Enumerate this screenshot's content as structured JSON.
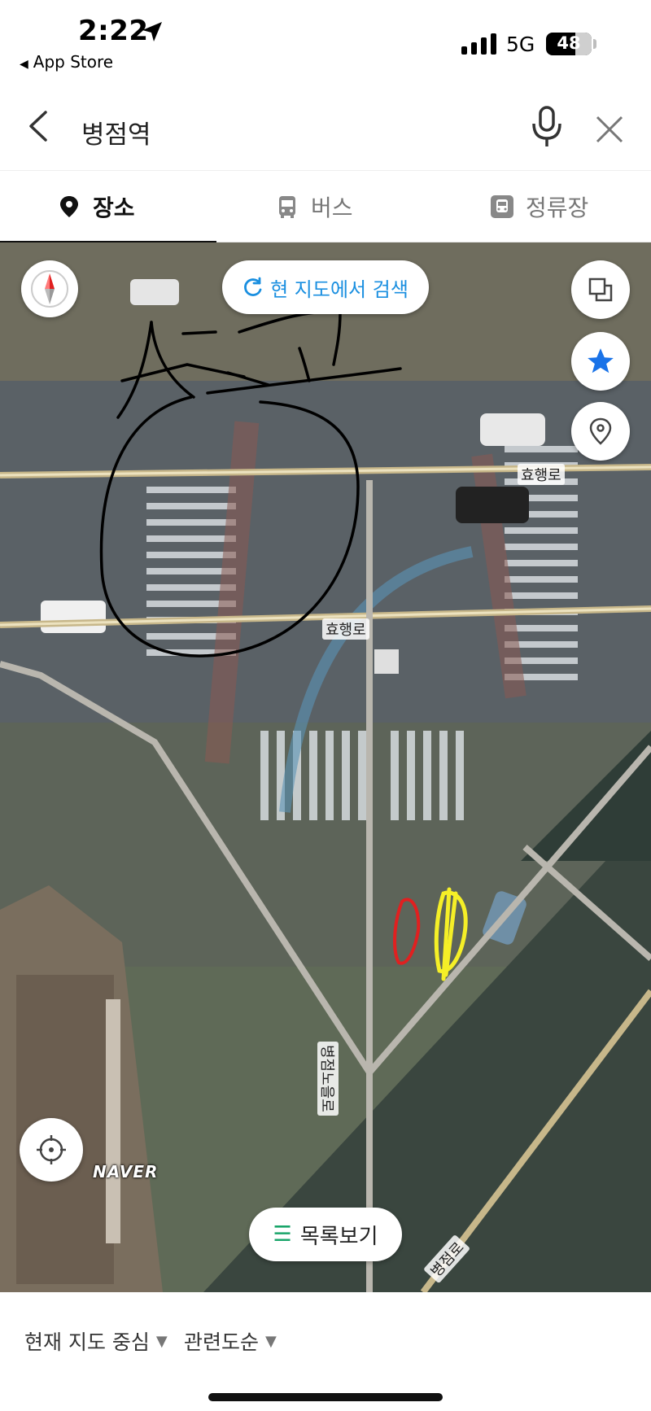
{
  "status_bar": {
    "time": "2:22",
    "back_app": "App Store",
    "network": "5G",
    "battery": "48"
  },
  "search": {
    "query": "병점역"
  },
  "tabs": [
    {
      "label": "장소",
      "icon": "place-pin-icon",
      "selected": true
    },
    {
      "label": "버스",
      "icon": "bus-icon",
      "selected": false
    },
    {
      "label": "정류장",
      "icon": "bus-stop-icon",
      "selected": false
    }
  ],
  "map": {
    "search_here": "현 지도에서 검색",
    "road_labels": [
      "효행로",
      "효행로",
      "병점노을로",
      "병점로"
    ],
    "logo": "NAVER",
    "handwriting": "사고",
    "list_view": "목록보기"
  },
  "bottom_sheet": {
    "sort_center": "현재 지도 중심",
    "sort_order": "관련도순"
  },
  "colors": {
    "accent_blue": "#1a8fe0",
    "list_green": "#1aa56a",
    "star_blue": "#1a73e8",
    "annotation_red": "#e02020",
    "annotation_yellow": "#f5ef27"
  }
}
